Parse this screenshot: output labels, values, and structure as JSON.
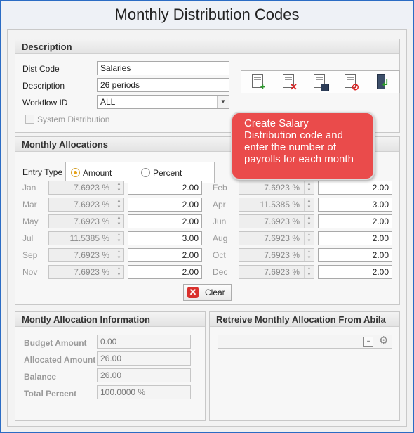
{
  "window": {
    "title": "Monthly Distribution Codes"
  },
  "description": {
    "header": "Description",
    "dist_code_label": "Dist Code",
    "dist_code_value": "Salaries",
    "description_label": "Description",
    "description_value": "26 periods",
    "workflow_label": "Workflow ID",
    "workflow_value": "ALL",
    "system_distribution_label": "System Distribution",
    "system_distribution_checked": false
  },
  "toolbar": {
    "buttons": [
      {
        "icon": "new-document-icon"
      },
      {
        "icon": "delete-document-icon"
      },
      {
        "icon": "save-icon"
      },
      {
        "icon": "cancel-document-icon"
      },
      {
        "icon": "exit-door-icon"
      }
    ]
  },
  "callout": {
    "lines": [
      "Create Salary",
      "Distribution code and",
      "enter the number of",
      "payrolls for each month"
    ],
    "color": "#ea4b4b"
  },
  "allocations": {
    "header": "Monthly Allocations",
    "entry_type_label": "Entry Type",
    "option_amount": "Amount",
    "option_percent": "Percent",
    "selected_option": "Amount",
    "months": [
      {
        "name": "Jan",
        "percent": "7.6923 %",
        "amount": "2.00"
      },
      {
        "name": "Feb",
        "percent": "7.6923 %",
        "amount": "2.00"
      },
      {
        "name": "Mar",
        "percent": "7.6923 %",
        "amount": "2.00"
      },
      {
        "name": "Apr",
        "percent": "11.5385 %",
        "amount": "3.00"
      },
      {
        "name": "May",
        "percent": "7.6923 %",
        "amount": "2.00"
      },
      {
        "name": "Jun",
        "percent": "7.6923 %",
        "amount": "2.00"
      },
      {
        "name": "Jul",
        "percent": "11.5385 %",
        "amount": "3.00"
      },
      {
        "name": "Aug",
        "percent": "7.6923 %",
        "amount": "2.00"
      },
      {
        "name": "Sep",
        "percent": "7.6923 %",
        "amount": "2.00"
      },
      {
        "name": "Oct",
        "percent": "7.6923 %",
        "amount": "2.00"
      },
      {
        "name": "Nov",
        "percent": "7.6923 %",
        "amount": "2.00"
      },
      {
        "name": "Dec",
        "percent": "7.6923 %",
        "amount": "2.00"
      }
    ],
    "clear_label": "Clear"
  },
  "info": {
    "header": "Montly Allocation Information",
    "budget_label": "Budget Amount",
    "budget_value": "0.00",
    "allocated_label": "Allocated Amount",
    "allocated_value": "26.00",
    "balance_label": "Balance",
    "balance_value": "26.00",
    "total_percent_label": "Total Percent",
    "total_percent_value": "100.0000 %"
  },
  "retrieve": {
    "header": "Retreive Monthly Allocation From Abila",
    "value": ""
  }
}
